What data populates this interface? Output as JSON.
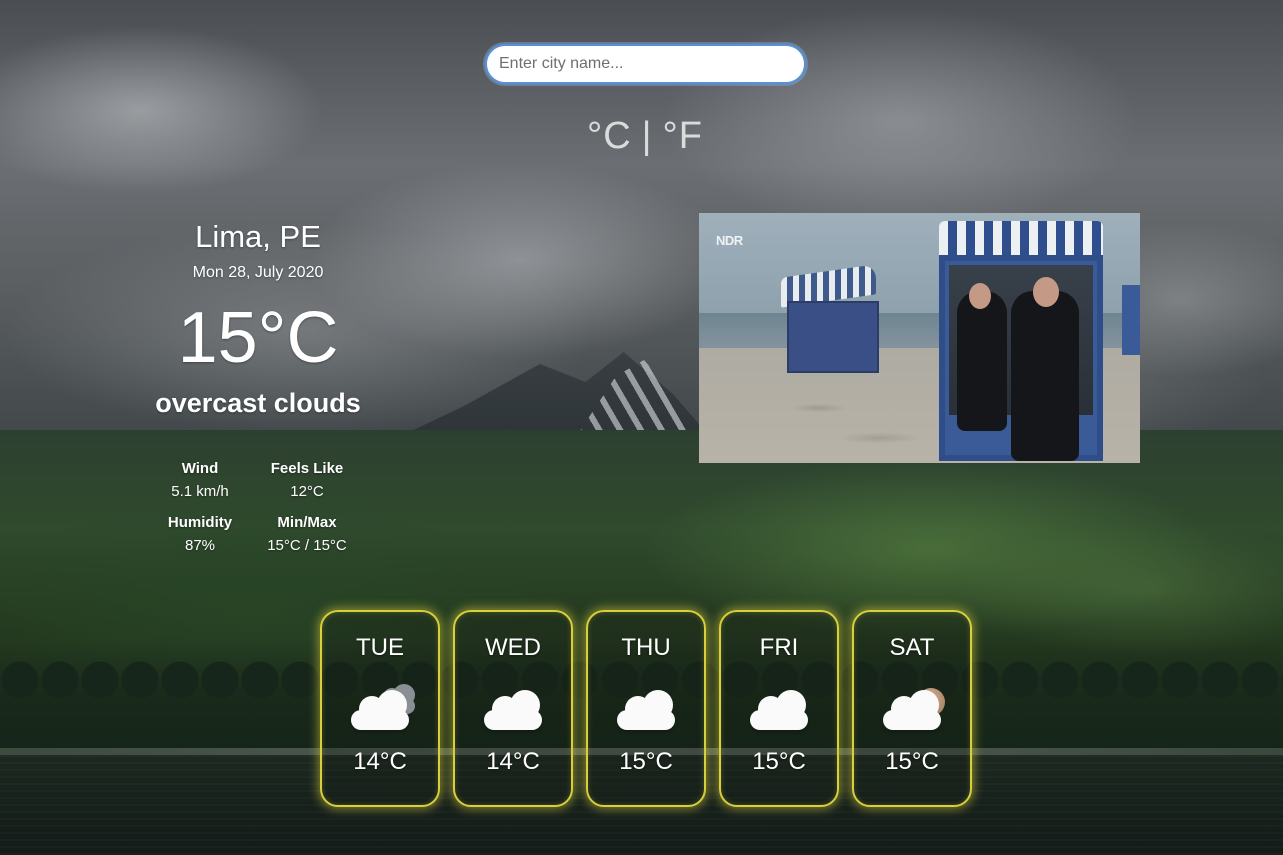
{
  "search": {
    "placeholder": "Enter city name..."
  },
  "units": {
    "celsius": "°C",
    "separator": "|",
    "fahrenheit": "°F"
  },
  "current": {
    "location": "Lima, PE",
    "date": "Mon 28, July 2020",
    "temperature": "15°C",
    "description": "overcast clouds",
    "details": [
      {
        "label": "Wind",
        "value": "5.1 km/h"
      },
      {
        "label": "Feels Like",
        "value": "12°C"
      },
      {
        "label": "Humidity",
        "value": "87%"
      },
      {
        "label": "Min/Max",
        "value": "15°C / 15°C"
      }
    ]
  },
  "photo": {
    "logo": "NDR"
  },
  "forecast": [
    {
      "day": "TUE",
      "icon": "broken-clouds-icon",
      "temp": "14°C"
    },
    {
      "day": "WED",
      "icon": "cloud-icon",
      "temp": "14°C"
    },
    {
      "day": "THU",
      "icon": "cloud-icon",
      "temp": "15°C"
    },
    {
      "day": "FRI",
      "icon": "cloud-icon",
      "temp": "15°C"
    },
    {
      "day": "SAT",
      "icon": "cloud-moon-icon",
      "temp": "15°C"
    }
  ],
  "colors": {
    "card_border": "#d8cf3a",
    "search_border": "#5b8fd6",
    "text": "#ffffff"
  }
}
